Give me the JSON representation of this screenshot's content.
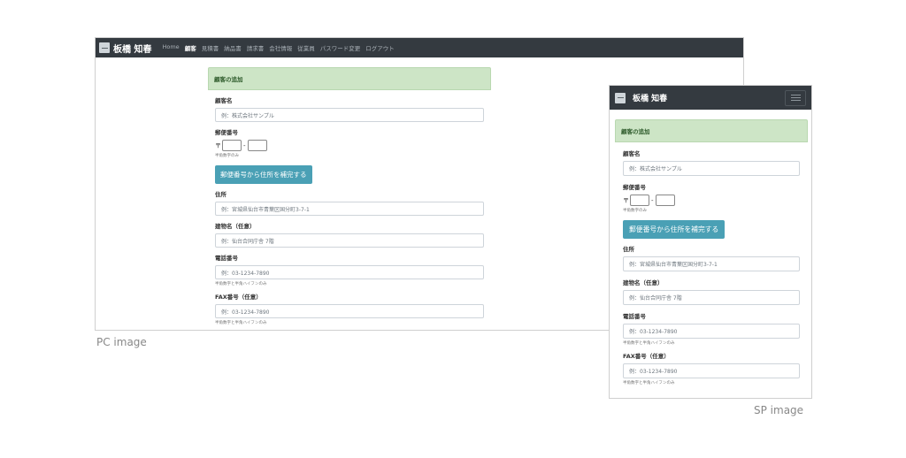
{
  "brand": {
    "name": "板橋 知春"
  },
  "nav": {
    "items": [
      "Home",
      "顧客",
      "見積書",
      "納品書",
      "請求書",
      "会社情報",
      "従業員",
      "パスワード変更",
      "ログアウト"
    ],
    "active_index": 1
  },
  "form": {
    "title": "顧客の追加",
    "customer_name": {
      "label": "顧客名",
      "placeholder": "例：株式会社サンプル"
    },
    "postal": {
      "label": "郵便番号",
      "mark": "〒",
      "dash": "-",
      "help": "半角数字のみ"
    },
    "fill_button": "郵便番号から住所を補完する",
    "address": {
      "label": "住所",
      "placeholder": "例：宮城県仙台市青葉区国分町3-7-1"
    },
    "building": {
      "label": "建物名（任意）",
      "placeholder": "例：仙台合同庁舎 7階"
    },
    "phone": {
      "label": "電話番号",
      "placeholder": "例：03-1234-7890",
      "help": "半角数字と半角ハイフンのみ"
    },
    "fax": {
      "label": "FAX番号（任意）",
      "placeholder": "例：03-1234-7890",
      "help": "半角数字と半角ハイフンのみ"
    }
  },
  "captions": {
    "pc": "PC image",
    "sp": "SP image"
  },
  "colors": {
    "navbar": "#343a40",
    "card_header": "#cde5c6",
    "button": "#4aa0b5"
  }
}
